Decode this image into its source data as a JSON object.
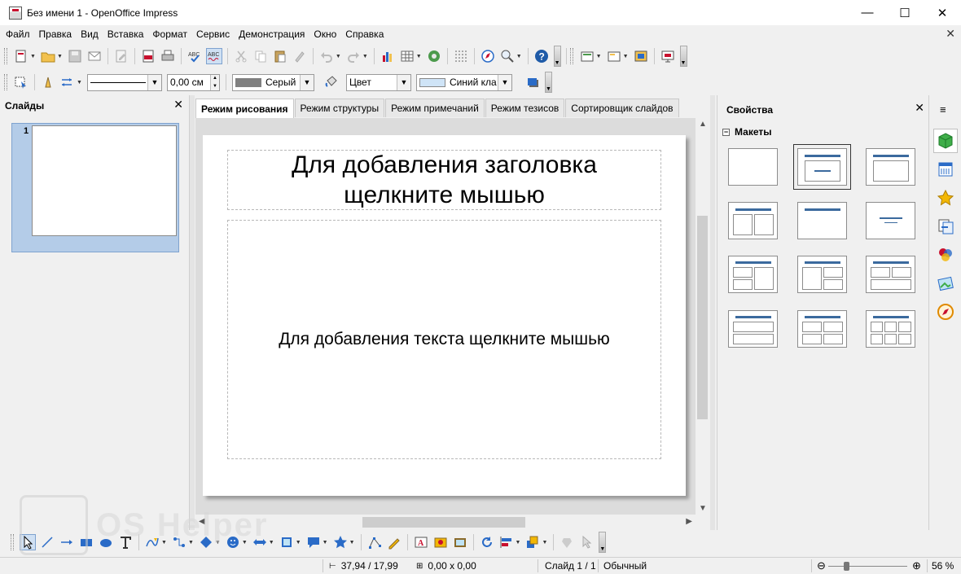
{
  "window": {
    "title": "Без имени 1 - OpenOffice Impress",
    "controls": {
      "minimize": "—",
      "maximize": "☐",
      "close": "✕"
    }
  },
  "menu": {
    "items": [
      "Файл",
      "Правка",
      "Вид",
      "Вставка",
      "Формат",
      "Сервис",
      "Демонстрация",
      "Окно",
      "Справка"
    ],
    "doc_close": "✕"
  },
  "line_toolbar": {
    "line_width": "0,00 см",
    "line_color": "Серый",
    "area_style": "Цвет",
    "area_fill": "Синий кла",
    "line_color_swatch": "#808080",
    "area_fill_swatch": "#cfe4f7"
  },
  "slides_pane": {
    "title": "Слайды",
    "close": "✕",
    "slide_number": "1"
  },
  "view_tabs": [
    "Режим рисования",
    "Режим структуры",
    "Режим примечаний",
    "Режим тезисов",
    "Сортировщик слайдов"
  ],
  "slide": {
    "title_placeholder": "Для добавления заголовка щелкните мышью",
    "body_placeholder": "Для добавления текста щелкните мышью"
  },
  "properties": {
    "title": "Свойства",
    "close": "✕",
    "menu_glyph": "≡",
    "section": "Макеты",
    "collapse": "−"
  },
  "status": {
    "position": "37,94 / 17,99",
    "size": "0,00 x 0,00",
    "slide": "Слайд 1 / 1",
    "master": "Обычный",
    "zoom": "56 %",
    "zoom_level": 0.56
  },
  "watermark": {
    "text": "OS Helper"
  },
  "colors": {
    "accent": "#3b6a9e",
    "selection": "#b4cce8"
  }
}
